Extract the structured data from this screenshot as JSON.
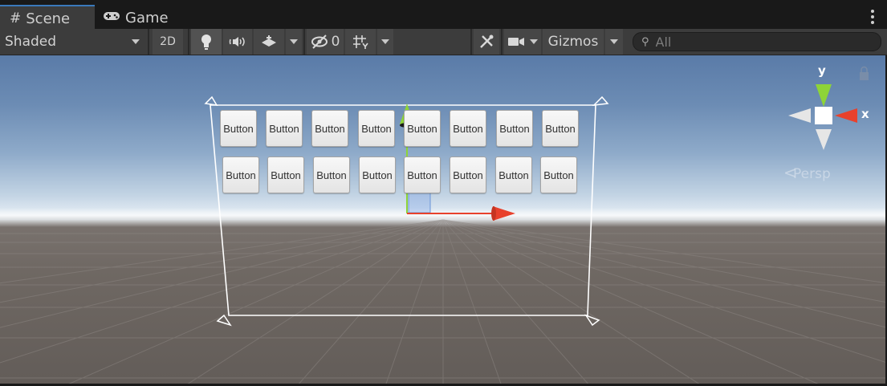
{
  "tabs": [
    {
      "label": "Scene",
      "icon": "grid-icon",
      "active": true
    },
    {
      "label": "Game",
      "icon": "gamepad-icon",
      "active": false
    }
  ],
  "toolbar": {
    "draw_mode": "Shaded",
    "mode_2d": "2D",
    "hidden_count": "0",
    "gizmos_label": "Gizmos",
    "search_placeholder": "All"
  },
  "canvas": {
    "buttons_row1": [
      "Button",
      "Button",
      "Button",
      "Button",
      "Button",
      "Button",
      "Button",
      "Button"
    ],
    "buttons_row2": [
      "Button",
      "Button",
      "Button",
      "Button",
      "Button",
      "Button",
      "Button",
      "Button"
    ]
  },
  "orientation_gizmo": {
    "y_label": "y",
    "x_label": "x",
    "projection_label": "Persp"
  },
  "colors": {
    "x_axis": "#e8412c",
    "y_axis": "#8ed438",
    "active_tab_accent": "#3a79bb"
  }
}
